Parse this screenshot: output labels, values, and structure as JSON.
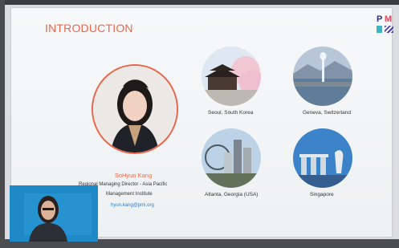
{
  "slide": {
    "title": "INTRODUCTION",
    "speaker": {
      "name": "SoHyun Kang",
      "role_line1": "Regional Managing Director - Asia Pacific",
      "role_line2": "Management Institute",
      "email": "hyun.kang@pmi.org"
    },
    "cities": [
      {
        "label": "Seoul, South Korea"
      },
      {
        "label": "Geneva, Switzerland"
      },
      {
        "label": "Atlanta, Georgia (USA)"
      },
      {
        "label": "Singapore"
      }
    ]
  },
  "logo": {
    "letters_top": "P",
    "letters_top2": "M"
  },
  "colors": {
    "accent": "#e9664a",
    "link": "#2d7fc7",
    "camera_bg": "#1d89c7"
  }
}
